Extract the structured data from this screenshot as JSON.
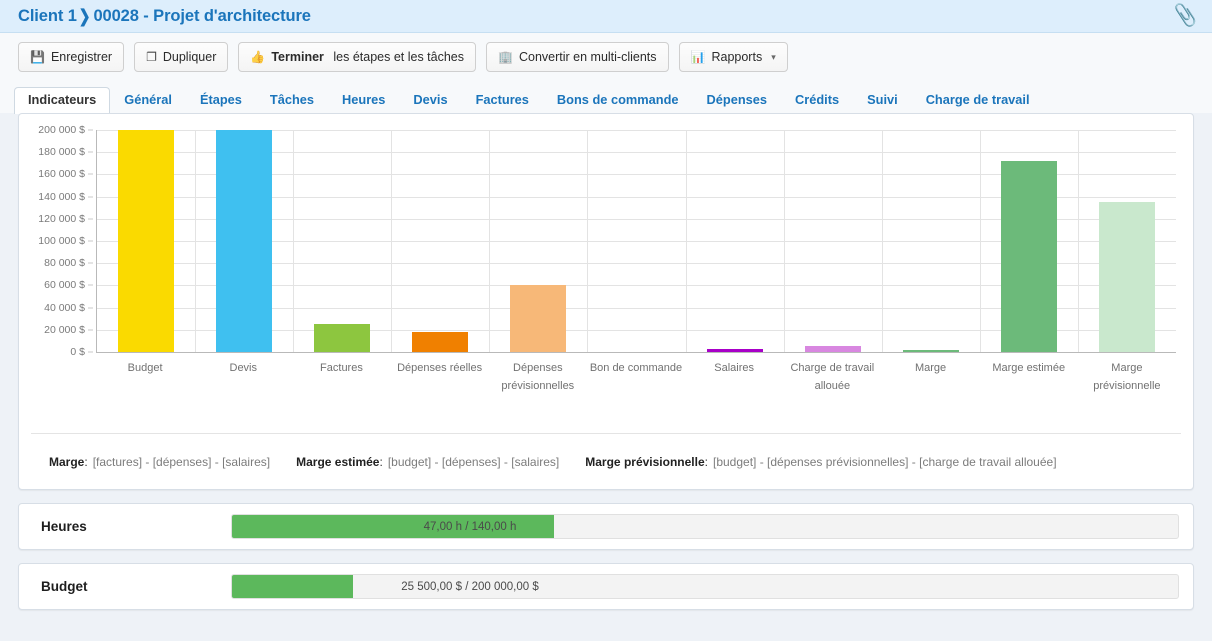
{
  "header": {
    "breadcrumb_client": "Client 1",
    "breadcrumb_sep": "❯",
    "breadcrumb_project": "00028 - Projet d'architecture",
    "attachment_icon": "paperclip-icon",
    "bg_color": "#ddeefc",
    "text_color": "#1b75bb"
  },
  "toolbar": {
    "buttons": [
      {
        "icon": "save-icon",
        "glyph": "💾",
        "label": "Enregistrer",
        "bold_label": "",
        "caret": ""
      },
      {
        "icon": "duplicate-icon",
        "glyph": "❐",
        "label": "Dupliquer",
        "bold_label": "",
        "caret": ""
      },
      {
        "icon": "thumbs-up-icon",
        "glyph": "👍",
        "label": " les étapes et les tâches",
        "bold_label": "Terminer",
        "caret": ""
      },
      {
        "icon": "building-icon",
        "glyph": "🏢",
        "label": "Convertir en multi-clients",
        "bold_label": "",
        "caret": ""
      },
      {
        "icon": "chart-bar-icon",
        "glyph": "📊",
        "label": "Rapports",
        "bold_label": "",
        "caret": "▾"
      }
    ]
  },
  "tabs": [
    {
      "label": "Indicateurs",
      "active": true
    },
    {
      "label": "Général",
      "active": false
    },
    {
      "label": "Étapes",
      "active": false
    },
    {
      "label": "Tâches",
      "active": false
    },
    {
      "label": "Heures",
      "active": false
    },
    {
      "label": "Devis",
      "active": false
    },
    {
      "label": "Factures",
      "active": false
    },
    {
      "label": "Bons de commande",
      "active": false
    },
    {
      "label": "Dépenses",
      "active": false
    },
    {
      "label": "Crédits",
      "active": false
    },
    {
      "label": "Suivi",
      "active": false
    },
    {
      "label": "Charge de travail",
      "active": false
    }
  ],
  "chart_data": {
    "type": "bar",
    "title": "",
    "xlabel": "",
    "ylabel": "",
    "ylim": [
      0,
      200000
    ],
    "ytick_step": 20000,
    "currency_suffix": "$",
    "grid": true,
    "legend": "none",
    "ytick_labels": [
      "0 $",
      "20 000 $",
      "40 000 $",
      "60 000 $",
      "80 000 $",
      "100 000 $",
      "120 000 $",
      "140 000 $",
      "160 000 $",
      "180 000 $",
      "200 000 $"
    ],
    "categories": [
      "Budget",
      "Devis",
      "Factures",
      "Dépenses réelles",
      "Dépenses prévisionnelles",
      "Bon de commande",
      "Salaires",
      "Charge de travail allouée",
      "Marge",
      "Marge estimée",
      "Marge prévisionnelle"
    ],
    "values": [
      200000,
      200000,
      25500,
      18000,
      60000,
      0,
      3000,
      5000,
      1500,
      172000,
      135000
    ],
    "colors": [
      "#fada00",
      "#3fc0f0",
      "#8dc63f",
      "#f08000",
      "#f7b878",
      "#cccccc",
      "#a800c8",
      "#d887e0",
      "#6cba7a",
      "#6cba7a",
      "#c9e8cd"
    ],
    "hatched": [
      false,
      false,
      false,
      false,
      true,
      false,
      false,
      false,
      false,
      false,
      true
    ]
  },
  "formulas": [
    {
      "name": "Marge",
      "expr": "[factures] - [dépenses] - [salaires]"
    },
    {
      "name": "Marge estimée",
      "expr": "[budget] - [dépenses] - [salaires]"
    },
    {
      "name": "Marge prévisionnelle",
      "expr": "[budget] - [dépenses prévisionnelles] - [charge de travail allouée]"
    }
  ],
  "progress_rows": [
    {
      "label": "Heures",
      "text": "47,00 h / 140,00 h",
      "percent": 34
    },
    {
      "label": "Budget",
      "text": "25 500,00 $ / 200 000,00 $",
      "percent": 12.75
    }
  ]
}
